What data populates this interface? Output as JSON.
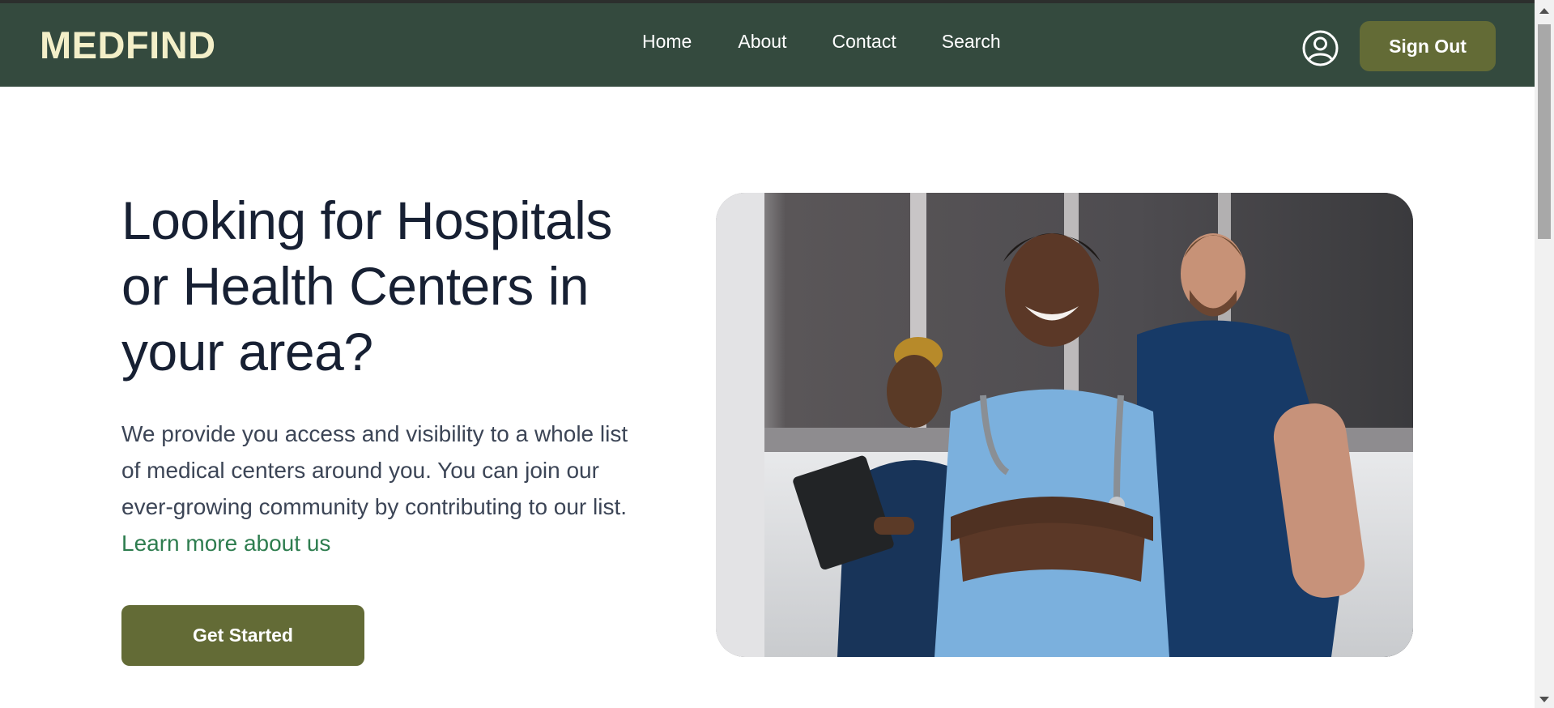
{
  "app": {
    "logo": "MEDFIND"
  },
  "nav": {
    "links": [
      {
        "label": "Home"
      },
      {
        "label": "About"
      },
      {
        "label": "Contact"
      },
      {
        "label": "Search"
      }
    ],
    "profile_icon": "user-circle-icon",
    "signout_label": "Sign Out"
  },
  "hero": {
    "headline": "Looking for Hospitals or Health Centers in your area?",
    "description": "We provide you access and visibility to a whole list of medical centers around you. You can join our ever-growing community by contributing to our list.",
    "learn_more_label": "Learn more about us",
    "cta_label": "Get Started",
    "image": "medical-staff-photo"
  },
  "colors": {
    "navbar": "#344a3e",
    "logo": "#f3efc8",
    "button": "#636b36",
    "link": "#2e7d4f",
    "heading": "#172033"
  }
}
